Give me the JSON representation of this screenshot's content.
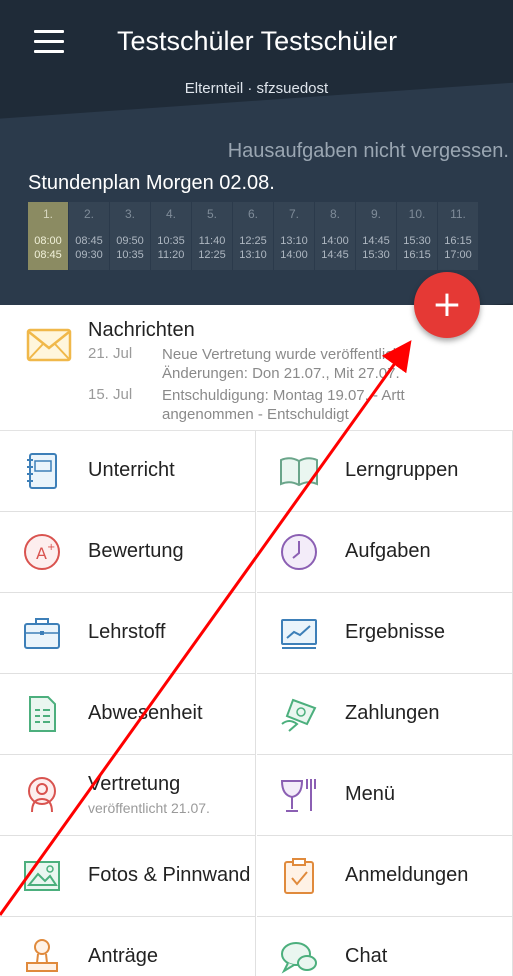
{
  "header": {
    "title": "Testschüler Testschüler",
    "subtitle": "Elternteil · sfzsuedost",
    "motto": "Hausaufgaben nicht vergessen.",
    "plan_title": "Stundenplan Morgen 02.08."
  },
  "periods": [
    {
      "num": "1.",
      "start": "08:00",
      "end": "08:45"
    },
    {
      "num": "2.",
      "start": "08:45",
      "end": "09:30"
    },
    {
      "num": "3.",
      "start": "09:50",
      "end": "10:35"
    },
    {
      "num": "4.",
      "start": "10:35",
      "end": "11:20"
    },
    {
      "num": "5.",
      "start": "11:40",
      "end": "12:25"
    },
    {
      "num": "6.",
      "start": "12:25",
      "end": "13:10"
    },
    {
      "num": "7.",
      "start": "13:10",
      "end": "14:00"
    },
    {
      "num": "8.",
      "start": "14:00",
      "end": "14:45"
    },
    {
      "num": "9.",
      "start": "14:45",
      "end": "15:30"
    },
    {
      "num": "10.",
      "start": "15:30",
      "end": "16:15"
    },
    {
      "num": "11.",
      "start": "16:15",
      "end": "17:00"
    }
  ],
  "fab": {
    "symbol": "+",
    "color": "#e53935"
  },
  "news": {
    "title": "Nachrichten",
    "items": [
      {
        "date": "21. Jul",
        "line1": "Neue Vertretung wurde veröffentlicht",
        "line2": "Änderungen: Don 21.07., Mit 27.07."
      },
      {
        "date": "15. Jul",
        "line1": "Entschuldigung: Montag 19.07. - Artt",
        "line2": "angenommen - Entschuldigt"
      }
    ]
  },
  "tiles": {
    "unterricht": "Unterricht",
    "lerngruppen": "Lerngruppen",
    "bewertung": "Bewertung",
    "aufgaben": "Aufgaben",
    "lehrstoff": "Lehrstoff",
    "ergebnisse": "Ergebnisse",
    "abwesenheit": "Abwesenheit",
    "zahlungen": "Zahlungen",
    "vertretung": "Vertretung",
    "vertretung_sub": "veröffentlicht 21.07.",
    "menu": "Menü",
    "fotos": "Fotos & Pinnwand",
    "anmeldungen": "Anmeldungen",
    "antraege": "Anträge",
    "chat": "Chat"
  },
  "colors": {
    "header_bg": "#1f2b38",
    "accent_red": "#e53935",
    "annotation": "#ff0000"
  }
}
